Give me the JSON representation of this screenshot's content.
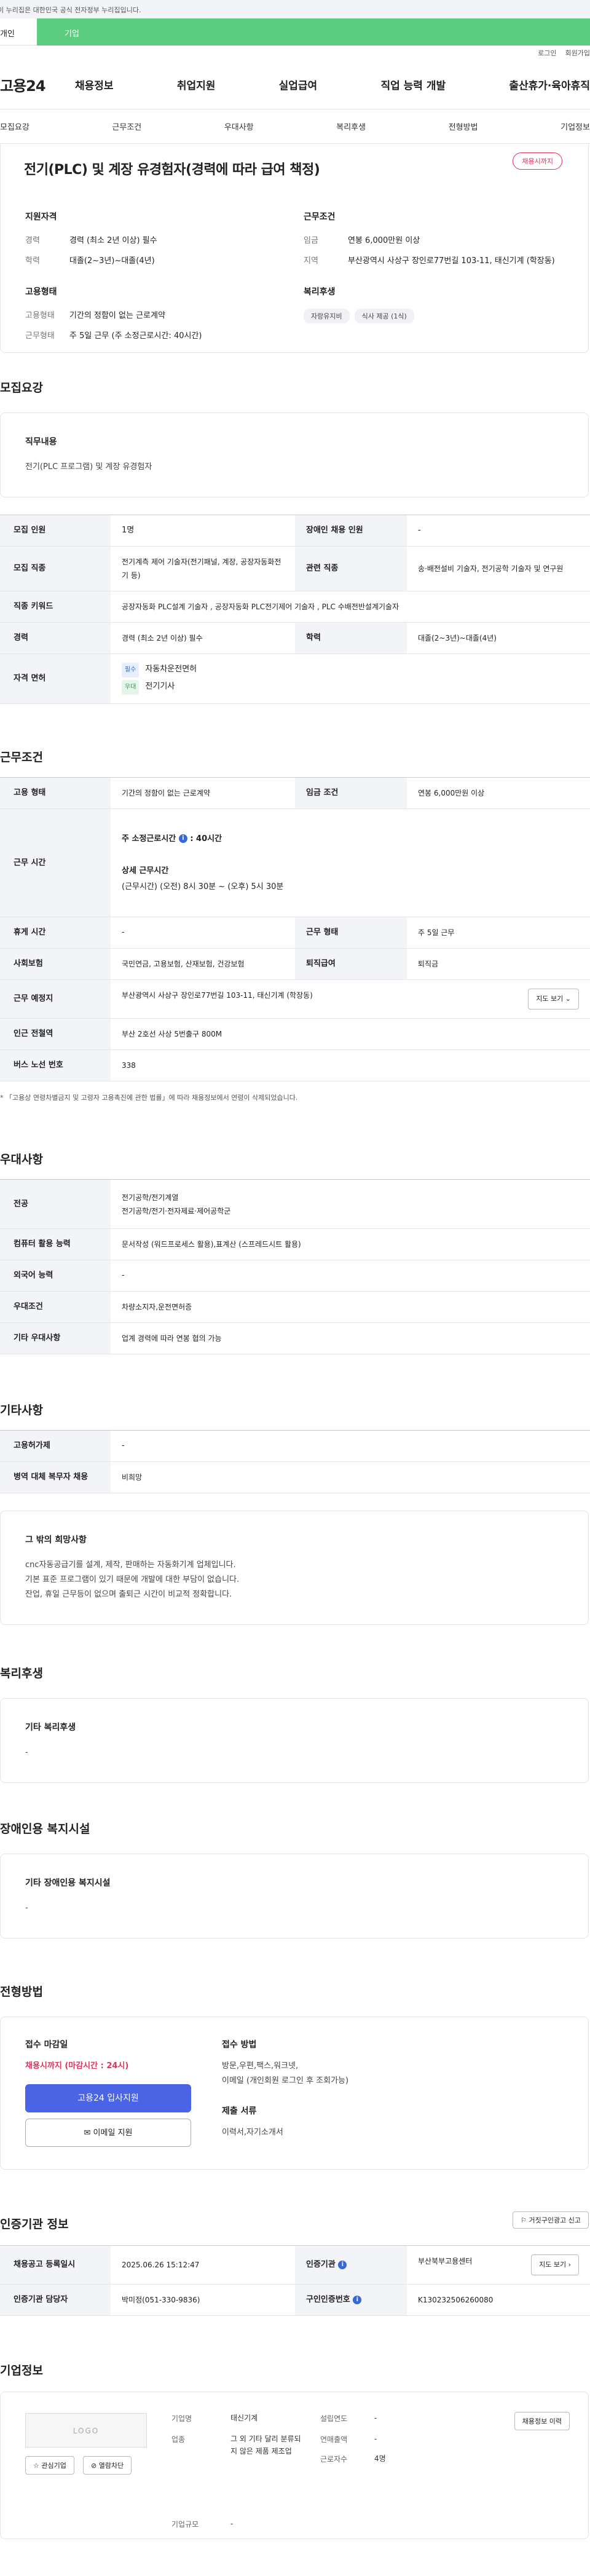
{
  "gov_banner": "이 누리집은 대한민국 공식 전자정부 누리집입니다.",
  "tabs": {
    "individual": "개인",
    "company": "기업"
  },
  "util": {
    "login": "로그인",
    "join": "회원가입"
  },
  "gnb": {
    "logo": "고용24",
    "menu": [
      "채용정보",
      "취업지원",
      "실업급여",
      "직업 능력 개발",
      "출산휴가·육아휴직"
    ]
  },
  "snb": [
    "모집요강",
    "근무조건",
    "우대사항",
    "복리후생",
    "전형방법",
    "기업정보"
  ],
  "job": {
    "title": "전기(PLC) 및 계장 유경험자(경력에 따라 급여 책정)",
    "badge": "채용시까지",
    "qual_title": "지원자격",
    "qual": [
      {
        "k": "경력",
        "v": "경력 (최소 2년 이상) 필수"
      },
      {
        "k": "학력",
        "v": "대졸(2~3년)~대졸(4년)"
      }
    ],
    "emp_title": "고용형태",
    "emp": [
      {
        "k": "고용형태",
        "v": "기간의 정함이 없는 근로계약"
      },
      {
        "k": "근무형태",
        "v": "주 5일 근무 (주 소정근로시간: 40시간)"
      }
    ],
    "cond_title": "근무조건",
    "cond": [
      {
        "k": "임금",
        "v": "연봉 6,000만원 이상"
      },
      {
        "k": "지역",
        "v": "부산광역시 사상구 장인로77번길 103-11, 태신기계 (학장동)"
      }
    ],
    "welfare_title": "복리후생",
    "welfare_chips": [
      "자랑유지비",
      "식사 제공 (1식)"
    ]
  },
  "recruit": {
    "title": "모집요강",
    "duty_h": "직무내용",
    "duty": "전기(PLC 프로그램) 및 계장 유경험자",
    "rows": {
      "count_k": "모집 인원",
      "count_v": "1명",
      "disabled_k": "장애인 채용 인원",
      "disabled_v": "-",
      "job_k": "모집 직종",
      "job_v": "전기계측 제어 기술자(전기패널, 계장, 공장자동화전기 등)",
      "related_k": "관련 직종",
      "related_v": "송·배전설비 기술자, 전기공학 기술자 및 연구원",
      "kw_k": "직종 키워드",
      "kw_v": "공장자동화 PLC설계 기술자 , 공장자동화 PLC전기제어 기술자 , PLC 수배전반설계기술자",
      "career_k": "경력",
      "career_v": "경력 (최소 2년 이상) 필수",
      "edu_k": "학력",
      "edu_v": "대졸(2~3년)~대졸(4년)",
      "license_k": "자격 면허",
      "license_1_tag": "필수",
      "license_1": "자동차운전면허",
      "license_2_tag": "우대",
      "license_2": "전기기사"
    }
  },
  "work": {
    "title": "근무조건",
    "type_k": "고용 형태",
    "type_v": "기간의 정함이 없는 근로계약",
    "wage_k": "임금 조건",
    "wage_v": "연봉 6,000만원 이상",
    "hours_k": "근무 시간",
    "hours_week_label": "주 소정근로시간",
    "hours_week_value": ": 40시간",
    "hours_detail_h": "상세 근무시간",
    "hours_detail": "(근무시간) (오전) 8시 30분 ~ (오후) 5시 30분",
    "rest_k": "휴게 시간",
    "rest_v": "-",
    "form_k": "근무 형태",
    "form_v": "주 5일 근무",
    "ins_k": "사회보험",
    "ins_v": "국민연금, 고용보험, 산재보험, 건강보험",
    "retire_k": "퇴직급여",
    "retire_v": "퇴직금",
    "place_k": "근무 예정지",
    "place_v": "부산광역시 사상구 장인로77번길 103-11, 태신기계 (학장동)",
    "map_btn": "지도 보기",
    "subway_k": "인근 전철역",
    "subway_v": "부산 2호선 사상 5번출구 800M",
    "bus_k": "버스 노선 번호",
    "bus_v": "338",
    "note": "* 「고용상 연령차별금지 및 고령자 고용촉진에 관한 법률」에 따라 채용정보에서 연령이 삭제되었습니다."
  },
  "pref": {
    "title": "우대사항",
    "major_k": "전공",
    "major_v1": "전기공학/전기계열",
    "major_v2": "전기공학/전기·전자제료·제어공학군",
    "pc_k": "컴퓨터 활용 능력",
    "pc_v": "문서작성 (워드프로세스 활용),표계산 (스프레드시트 활용)",
    "lang_k": "외국어 능력",
    "lang_v": "-",
    "cond_k": "우대조건",
    "cond_v": "차량소지자,운전면허증",
    "etc_k": "기타 우대사항",
    "etc_v": "업계 경력에 따라 연봉 협의 가능"
  },
  "etc": {
    "title": "기타사항",
    "emp_ins_k": "고용허가제",
    "emp_ins_v": "-",
    "military_k": "병역 대체 복무자 채용",
    "military_v": "비희망",
    "hope_h": "그 밖의 희망사항",
    "hope": [
      "cnc자동공급기를 설계, 제작, 판매하는 자동화기계 업체입니다.",
      "기본 표준 프로그램이 있기 때문에 개발에 대한 부담이 없습니다.",
      "잔업, 휴일 근무등이 없으며 출퇴근 시간이 비교적 정확합니다."
    ]
  },
  "welfare": {
    "title": "복리후생",
    "h": "기타 복리후생",
    "v": "-"
  },
  "disabled": {
    "title": "장애인용 복지시설",
    "h": "기타 장애인용 복지시설",
    "v": "-"
  },
  "apply": {
    "title": "전형방법",
    "deadline_h": "접수 마감일",
    "deadline": "채용시까지 (마감시간 : 24시)",
    "btn_apply": "고용24 입사지원",
    "btn_email": "이메일 지원",
    "method_h": "접수 방법",
    "method": "방문,우편,팩스,워크넷,\n이메일 (개인회원 로그인 후 조회가능)",
    "docs_h": "제출 서류",
    "docs": "이력서,자기소개서"
  },
  "cert": {
    "title": "인증기관 정보",
    "report_btn": "거짓구인광고 신고",
    "reg_k": "채용공고 등록일시",
    "reg_v": "2025.06.26 15:12:47",
    "org_k": "인증기관",
    "org_v": "부산북부고용센터",
    "map_btn": "지도 보기",
    "staff_k": "인증기관 담당자",
    "staff_v": "박미정(051-330-9836)",
    "code_k": "구인인증번호",
    "code_v": "K130232506260080"
  },
  "corp": {
    "title": "기업정보",
    "logo": "LOGO",
    "btn_interest": "관심기업",
    "btn_block": "열람차단",
    "btn_history": "채용정보 이력",
    "name_k": "기업명",
    "name_v": "태신기계",
    "industry_k": "업종",
    "industry_v": "그 외 기타 달리 분류되지 않은 제품 제조업",
    "scale_k": "기업규모",
    "scale_v": "-",
    "founded_k": "설립연도",
    "founded_v": "-",
    "sales_k": "연매출액",
    "sales_v": "-",
    "staff_k": "근로자수",
    "staff_v": "4명"
  },
  "colors": {
    "accent": "#4b63e5",
    "tab_green": "#5ccd7e",
    "badge_red": "#e0335c",
    "deadline_red": "#e0335c"
  }
}
